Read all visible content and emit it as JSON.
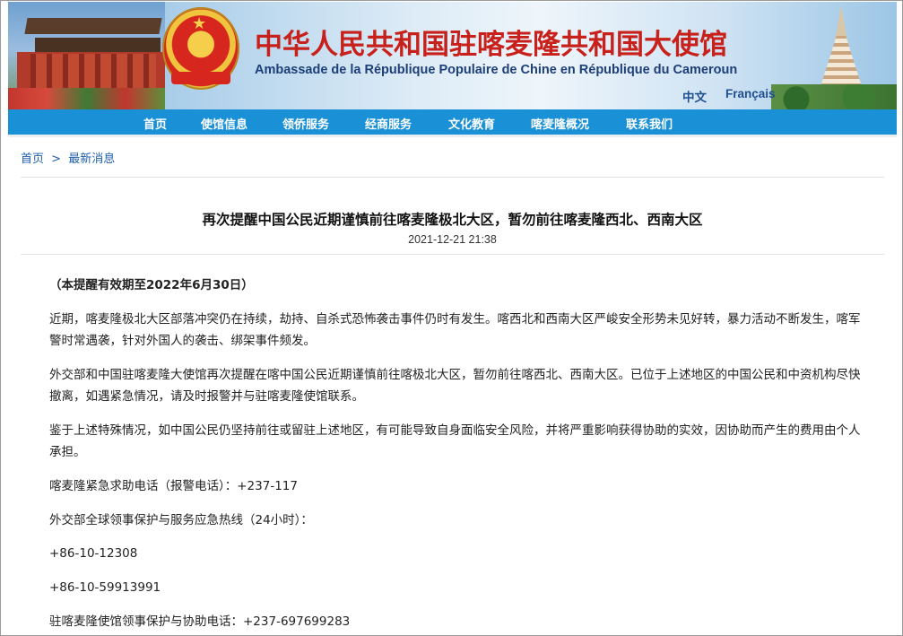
{
  "header": {
    "title_cn": "中华人民共和国驻喀麦隆共和国大使馆",
    "title_fr": "Ambassade de la République Populaire de Chine en République du Cameroun",
    "lang_cn": "中文",
    "lang_fr": "Français"
  },
  "nav": {
    "items": [
      "首页",
      "使馆信息",
      "领侨服务",
      "经商服务",
      "文化教育",
      "喀麦隆概况",
      "联系我们"
    ]
  },
  "breadcrumb": {
    "home": "首页",
    "separator": ">",
    "current": "最新消息"
  },
  "article": {
    "title": "再次提醒中国公民近期谨慎前往喀麦隆极北大区，暂勿前往喀麦隆西北、西南大区",
    "date": "2021-12-21 21:38",
    "validity": "（本提醒有效期至2022年6月30日）",
    "paragraphs": [
      "近期，喀麦隆极北大区部落冲突仍在持续，劫持、自杀式恐怖袭击事件仍时有发生。喀西北和西南大区严峻安全形势未见好转，暴力活动不断发生，喀军警时常遇袭，针对外国人的袭击、绑架事件频发。",
      "外交部和中国驻喀麦隆大使馆再次提醒在喀中国公民近期谨慎前往喀极北大区，暂勿前往喀西北、西南大区。已位于上述地区的中国公民和中资机构尽快撤离，如遇紧急情况，请及时报警并与驻喀麦隆使馆联系。",
      "鉴于上述特殊情况，如中国公民仍坚持前往或留驻上述地区，有可能导致自身面临安全风险，并将严重影响获得协助的实效，因协助而产生的费用由个人承担。"
    ],
    "lines": [
      "喀麦隆紧急求助电话（报警电话）：+237-117",
      "外交部全球领事保护与服务应急热线（24小时）：",
      "+86-10-12308",
      "+86-10-59913991",
      "驻喀麦隆使馆领事保护与协助电话：+237-697699283"
    ]
  },
  "colors": {
    "nav_bg": "#1a90d6",
    "title_red": "#c8201a",
    "link_blue": "#1e5fa8"
  }
}
